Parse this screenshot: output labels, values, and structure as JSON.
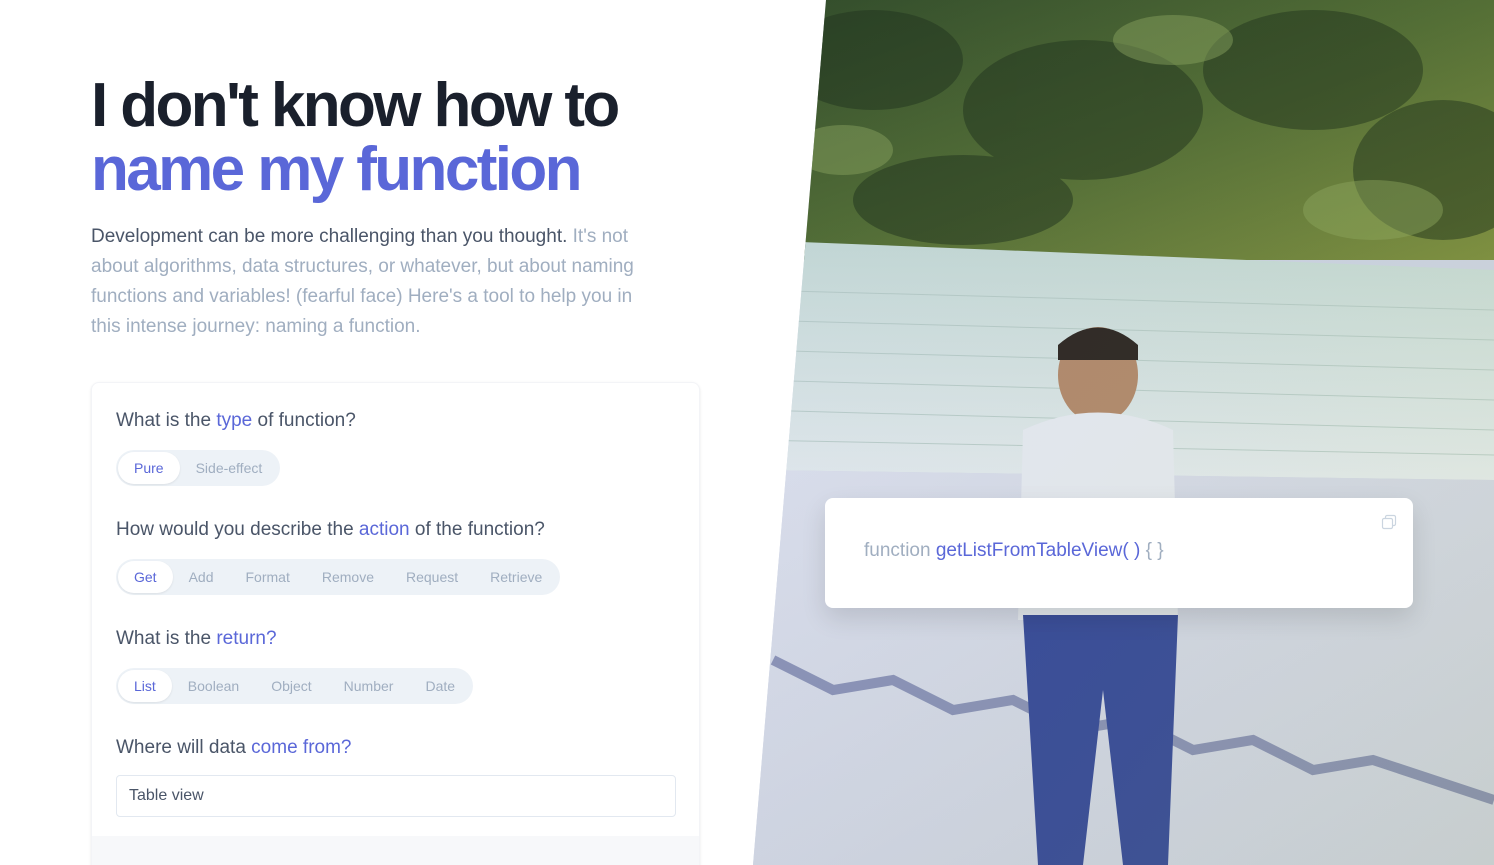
{
  "hero": {
    "title_line1": "I don't know how to",
    "title_line2": "name my function",
    "lead_strong": "Development can be more challenging than you thought.",
    "lead_rest": " It's not about algorithms, data structures, or whatever, but about naming functions and variables! (fearful face) Here's a tool to help you in this intense journey: naming a function."
  },
  "form": {
    "type_question": {
      "before": "What is the ",
      "highlight": "type",
      "after": " of function?"
    },
    "type_options": [
      "Pure",
      "Side-effect"
    ],
    "type_selected": "Pure",
    "action_question": {
      "before": "How would you describe the ",
      "highlight": "action",
      "after": " of the function?"
    },
    "action_options": [
      "Get",
      "Add",
      "Format",
      "Remove",
      "Request",
      "Retrieve"
    ],
    "action_selected": "Get",
    "return_question": {
      "before": "What is the ",
      "highlight": "return?",
      "after": ""
    },
    "return_options": [
      "List",
      "Boolean",
      "Object",
      "Number",
      "Date"
    ],
    "return_selected": "List",
    "source_question": {
      "before": "Where will data ",
      "highlight": "come from?",
      "after": ""
    },
    "source_value": "Table view"
  },
  "result": {
    "keyword": "function",
    "name": "getListFromTableView( )",
    "braces": "{ }",
    "copy_icon": "copy-icon"
  },
  "colors": {
    "accent": "#5a67d8",
    "heading": "#1a202c",
    "muted": "#a0aec0",
    "body": "#4a5568"
  }
}
